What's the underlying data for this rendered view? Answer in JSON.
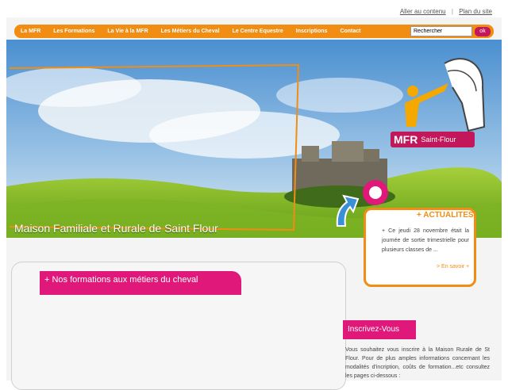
{
  "toplinks": {
    "skip": "Aller au contenu",
    "sitemap": "Plan du site"
  },
  "nav": [
    {
      "label": "La MFR"
    },
    {
      "label": "Les Formations"
    },
    {
      "label": "La Vie à la MFR"
    },
    {
      "label": "Les Métiers du Cheval"
    },
    {
      "label": "Le Centre Equestre"
    },
    {
      "label": "Inscriptions"
    },
    {
      "label": "Contact"
    }
  ],
  "search": {
    "value": "Rechercher",
    "button": "ok"
  },
  "hero": {
    "title": "Maison Familiale et Rurale de Saint Flour"
  },
  "logo": {
    "mfr": "MFR",
    "city": "Saint-Flour"
  },
  "actualites": {
    "title": "+ ACTUALITES",
    "text": "+ Ce jeudi 28 novembre était la journée de sortie trimestrielle pour plusieurs classes de ...",
    "more": "> En savoir +"
  },
  "formations": {
    "title": "+ Nos formations aux métiers du cheval"
  },
  "inscription": {
    "title": "Inscrivez-Vous",
    "text": "Vous souhaitez vous inscrire à la Maison Rurale de St Flour. Pour de plus amples informations concernant les modalités d'incription, coûts de formation...etc consultez les pages ci-dessous :"
  },
  "colors": {
    "orange": "#f08d12",
    "pink": "#e0187a",
    "magenta": "#c2175b"
  }
}
